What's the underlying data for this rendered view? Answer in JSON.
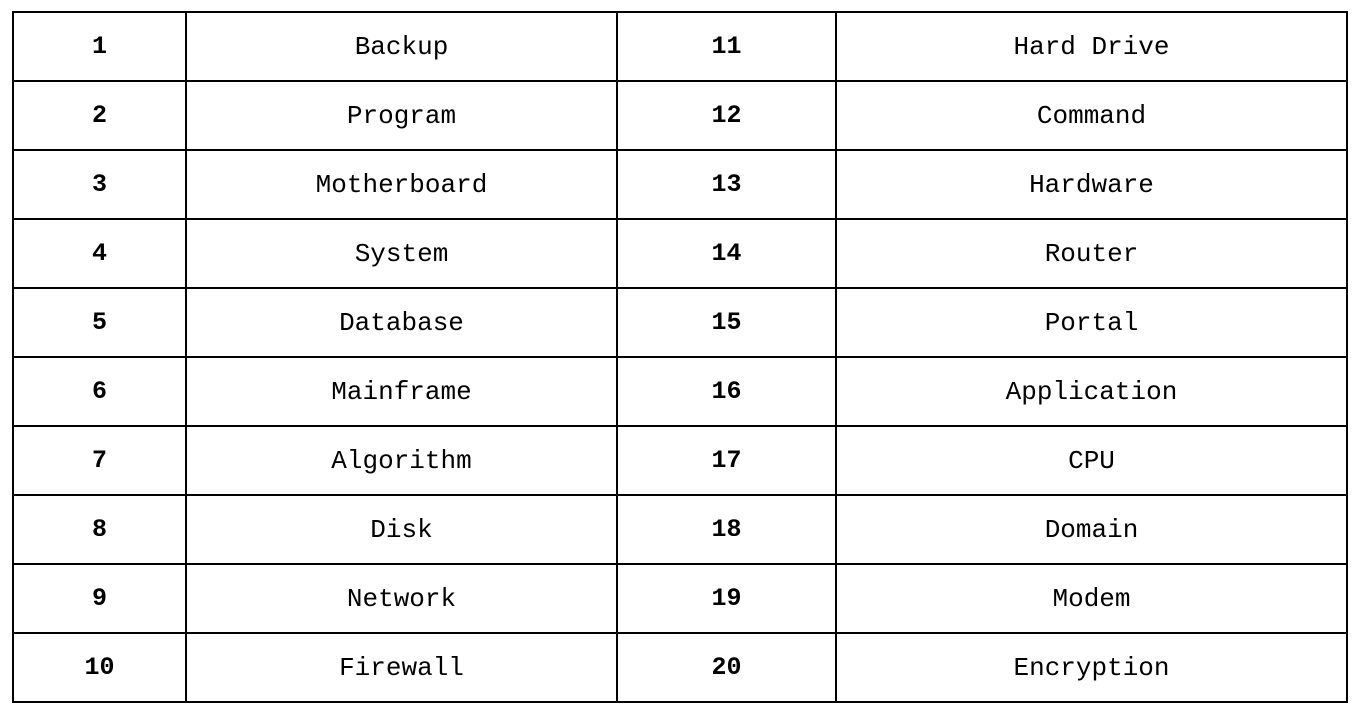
{
  "table": {
    "rows": [
      {
        "n1": "1",
        "t1": "Backup",
        "n2": "11",
        "t2": "Hard Drive"
      },
      {
        "n1": "2",
        "t1": "Program",
        "n2": "12",
        "t2": "Command"
      },
      {
        "n1": "3",
        "t1": "Motherboard",
        "n2": "13",
        "t2": "Hardware"
      },
      {
        "n1": "4",
        "t1": "System",
        "n2": "14",
        "t2": "Router"
      },
      {
        "n1": "5",
        "t1": "Database",
        "n2": "15",
        "t2": "Portal"
      },
      {
        "n1": "6",
        "t1": "Mainframe",
        "n2": "16",
        "t2": "Application"
      },
      {
        "n1": "7",
        "t1": "Algorithm",
        "n2": "17",
        "t2": "CPU"
      },
      {
        "n1": "8",
        "t1": "Disk",
        "n2": "18",
        "t2": "Domain"
      },
      {
        "n1": "9",
        "t1": "Network",
        "n2": "19",
        "t2": "Modem"
      },
      {
        "n1": "10",
        "t1": "Firewall",
        "n2": "20",
        "t2": "Encryption"
      }
    ]
  }
}
